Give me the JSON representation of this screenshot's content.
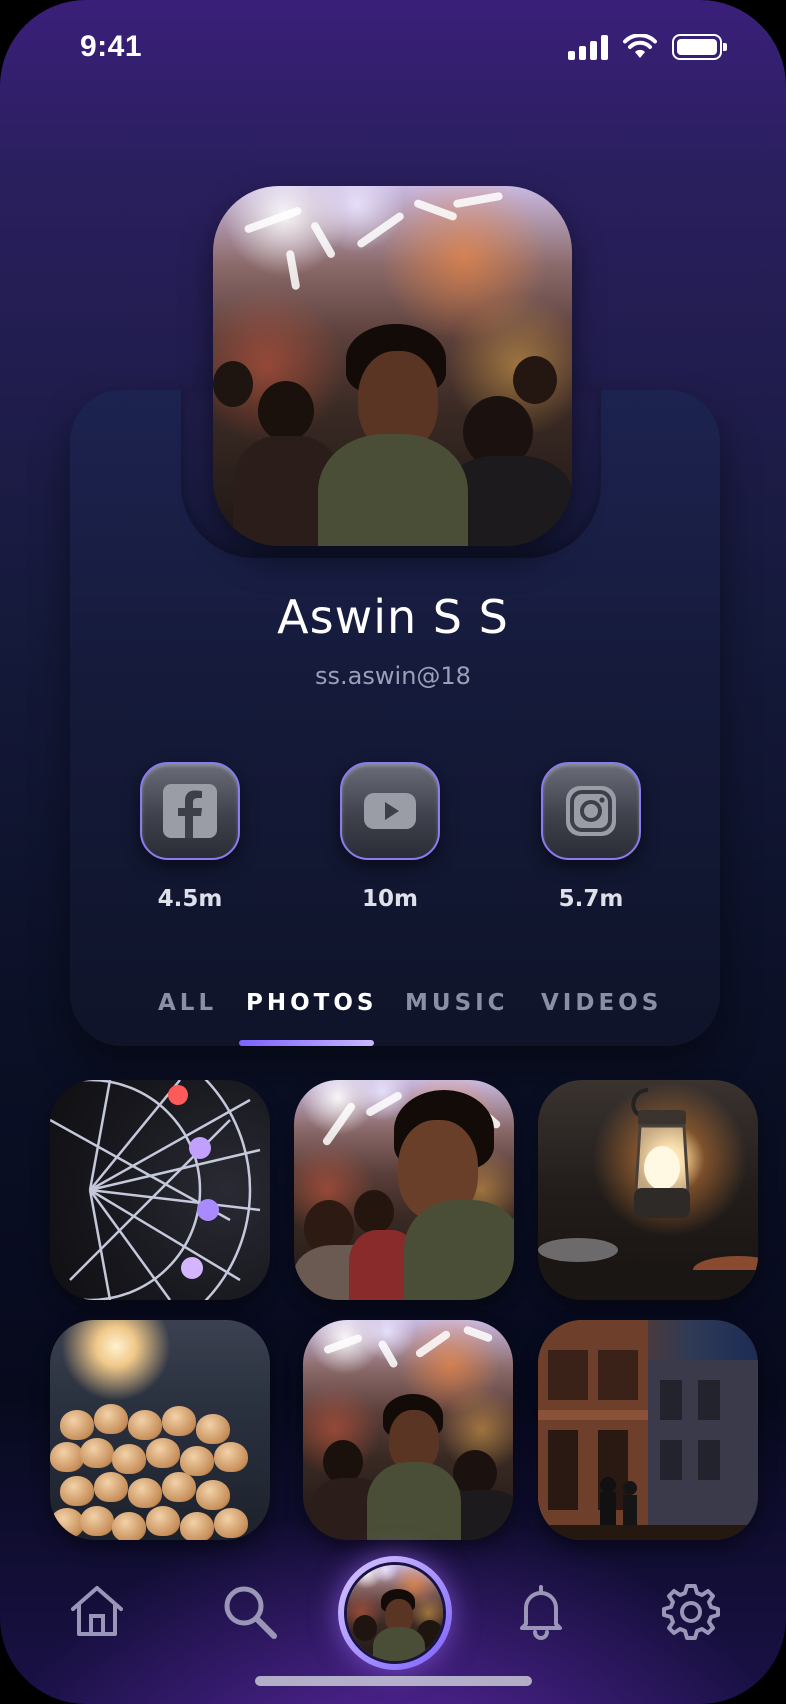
{
  "status_bar": {
    "time": "9:41"
  },
  "profile": {
    "name": "Aswin S S",
    "handle": "ss.aswin@18"
  },
  "socials": [
    {
      "network": "facebook",
      "icon": "facebook-icon",
      "count": "4.5m"
    },
    {
      "network": "youtube",
      "icon": "youtube-icon",
      "count": "10m"
    },
    {
      "network": "instagram",
      "icon": "instagram-icon",
      "count": "5.7m"
    }
  ],
  "tabs": [
    {
      "label": "ALL",
      "active": false
    },
    {
      "label": "PHOTOS",
      "active": true
    },
    {
      "label": "MUSIC",
      "active": false
    },
    {
      "label": "VIDEOS",
      "active": false
    }
  ],
  "nav": [
    "home-icon",
    "search-icon",
    "profile-avatar",
    "bell-icon",
    "gear-icon"
  ],
  "colors": {
    "accent": "#7b61ff",
    "background_top": "#3a1f7a",
    "background_mid": "#0b1026",
    "card": "#1d2350"
  }
}
